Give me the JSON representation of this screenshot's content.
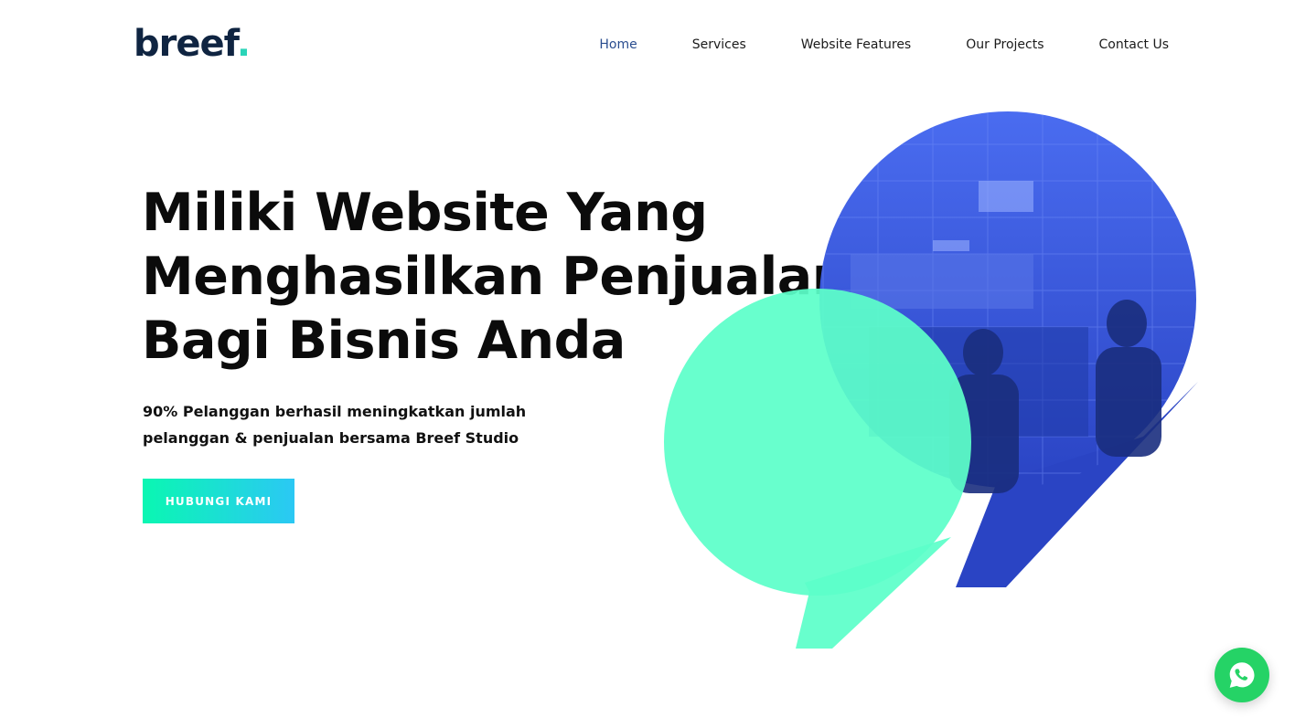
{
  "brand": {
    "logo_text": "breef",
    "logo_dot": ".",
    "accent": "#2ad4b8"
  },
  "nav": {
    "items": [
      {
        "label": "Home",
        "active": true
      },
      {
        "label": "Services",
        "active": false
      },
      {
        "label": "Website Features",
        "active": false
      },
      {
        "label": "Our Projects",
        "active": false
      },
      {
        "label": "Contact Us",
        "active": false
      }
    ]
  },
  "hero": {
    "title_lines": [
      "Miliki Website Yang",
      "Menghasilkan Penjualan",
      "Bagi Bisnis Anda"
    ],
    "subtitle_lines": [
      "90% Pelanggan berhasil meningkatkan jumlah",
      "pelanggan & penjualan bersama Breef Studio"
    ],
    "cta_label": "HUBUNGI KAMI"
  },
  "colors": {
    "nav_active": "#2a4d8f",
    "text": "#0b0b0b",
    "cta_gradient_start": "#0af7b2",
    "cta_gradient_end": "#2bc8f4",
    "bubble_blue": "#3b5ee0",
    "bubble_green": "#5cffc9",
    "whatsapp": "#25d366"
  },
  "icons": {
    "whatsapp": "whatsapp-icon"
  }
}
